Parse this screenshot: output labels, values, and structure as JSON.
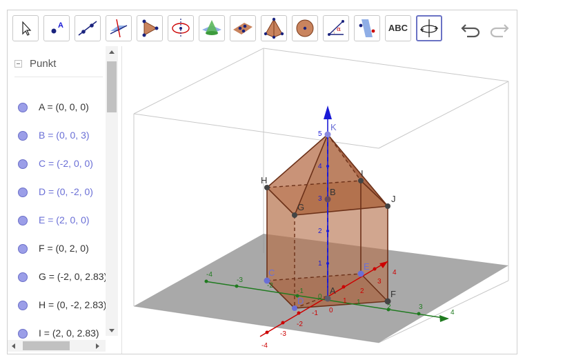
{
  "toolbar": {
    "tools": [
      {
        "name": "move-tool",
        "icon": "cursor-arrow-icon"
      },
      {
        "name": "point-tool",
        "icon": "point-icon",
        "label": "A"
      },
      {
        "name": "line-tool",
        "icon": "line-icon"
      },
      {
        "name": "perpendicular-line-tool",
        "icon": "perpendicular-line-icon"
      },
      {
        "name": "polygon-tool",
        "icon": "polygon-icon"
      },
      {
        "name": "circle-axis-tool",
        "icon": "circle-axis-icon"
      },
      {
        "name": "intersect-surfaces-tool",
        "icon": "cone-plane-icon"
      },
      {
        "name": "plane-tool",
        "icon": "plane-points-icon"
      },
      {
        "name": "pyramid-tool",
        "icon": "pyramid-icon"
      },
      {
        "name": "sphere-tool",
        "icon": "sphere-icon"
      },
      {
        "name": "angle-tool",
        "icon": "angle-icon",
        "label": "α"
      },
      {
        "name": "reflect-tool",
        "icon": "reflect-plane-icon"
      },
      {
        "name": "text-tool",
        "icon": "text-icon",
        "label": "ABC"
      },
      {
        "name": "rotate-view-tool",
        "icon": "rotate-3d-view-icon"
      }
    ],
    "active_tool": "rotate-view-tool",
    "undo_icon": "undo-icon",
    "redo_icon": "redo-icon"
  },
  "algebra": {
    "group_label": "Punkt",
    "items": [
      {
        "text": "A = (0, 0, 0)",
        "color": "#333333"
      },
      {
        "text": "B = (0, 0, 3)",
        "color": "#6a6fd6"
      },
      {
        "text": "C = (-2, 0, 0)",
        "color": "#6a6fd6"
      },
      {
        "text": "D = (0, -2, 0)",
        "color": "#6a6fd6"
      },
      {
        "text": "E = (2, 0, 0)",
        "color": "#6a6fd6"
      },
      {
        "text": "F = (0, 2, 0)",
        "color": "#333333"
      },
      {
        "text": "G = (-2, 0, 2.83)",
        "color": "#333333"
      },
      {
        "text": "H = (0, -2, 2.83)",
        "color": "#333333"
      },
      {
        "text": "I = (2, 0, 2.83)",
        "color": "#333333"
      }
    ]
  },
  "view": {
    "axis_colors": {
      "x": "#cc0000",
      "y": "#1f7a1f",
      "z": "#1a1ad6"
    },
    "x_ticks": [
      "-4",
      "-3",
      "-2",
      "-1",
      "0",
      "1",
      "2",
      "3",
      "4"
    ],
    "y_ticks": [
      "-4",
      "-3",
      "-2",
      "-1",
      "0",
      "1",
      "2",
      "3",
      "4"
    ],
    "z_ticks": [
      "1",
      "2",
      "3",
      "4",
      "5"
    ],
    "points": [
      "A",
      "B",
      "C",
      "D",
      "E",
      "F",
      "G",
      "H",
      "I",
      "J",
      "K"
    ],
    "solid_color": "#b5704a"
  }
}
